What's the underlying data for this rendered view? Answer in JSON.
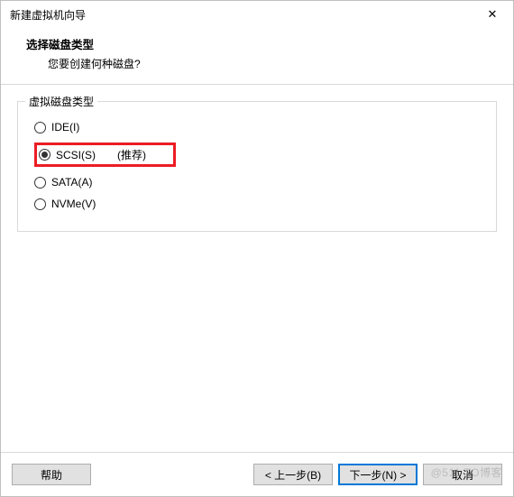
{
  "window": {
    "title": "新建虚拟机向导",
    "close_icon": "✕"
  },
  "header": {
    "title": "选择磁盘类型",
    "subtitle": "您要创建何种磁盘?"
  },
  "group": {
    "label": "虚拟磁盘类型",
    "options": [
      {
        "label": "IDE(I)",
        "checked": false
      },
      {
        "label": "SCSI(S)",
        "checked": true,
        "note": "(推荐)"
      },
      {
        "label": "SATA(A)",
        "checked": false
      },
      {
        "label": "NVMe(V)",
        "checked": false
      }
    ]
  },
  "footer": {
    "help": "帮助",
    "back": "< 上一步(B)",
    "next": "下一步(N) >",
    "cancel": "取消"
  },
  "watermark": "@511 TO博客"
}
